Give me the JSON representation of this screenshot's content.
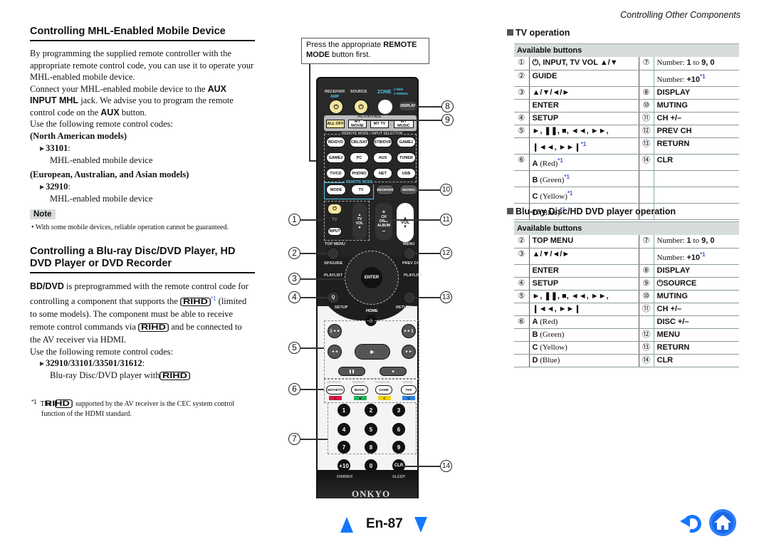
{
  "header": {
    "section_title": "Controlling Other Components"
  },
  "left": {
    "mhl": {
      "title": "Controlling MHL-Enabled Mobile Device",
      "para1": "By programming the supplied remote controller with the appropriate remote control code, you can use it to operate your MHL-enabled mobile device.",
      "para2_a": "Connect your MHL-enabled mobile device to the ",
      "para2_b": "AUX INPUT MHL",
      "para2_c": " jack. We advise you to program the remote control code on the ",
      "para2_d": "AUX",
      "para2_e": " button.",
      "para3": "Use the following remote control codes:",
      "groups": [
        {
          "region": "(North American models)",
          "code": "33101",
          "desc": "MHL-enabled mobile device"
        },
        {
          "region": "(European, Australian, and Asian models)",
          "code": "32910",
          "desc": "MHL-enabled mobile device"
        }
      ],
      "note_label": "Note",
      "note": "With some mobile devices, reliable operation cannot be guaranteed."
    },
    "bd": {
      "title": "Controlling a Blu-ray Disc/DVD Player, HD DVD Player or DVD Recorder",
      "p1_bold": "BD/DVD",
      "p1_a": " is preprogrammed with the remote control code for controlling a component that supports the ",
      "p1_b": " (limited to some models). The component must be able to receive remote control commands via ",
      "p1_c": " and be connected to the AV receiver via HDMI.",
      "p2": "Use the following remote control codes:",
      "code": "32910/33101/33501/31612",
      "desc": "Blu-ray Disc/DVD player with",
      "rihd": "RIHD",
      "footref": "*1",
      "footnote_a": "The ",
      "footnote_b": " supported by the AV receiver is the CEC system control function of the HDMI standard."
    }
  },
  "remote": {
    "callout_a": "Press the appropriate ",
    "callout_b": "REMOTE MODE",
    "callout_c": " button first.",
    "labels": {
      "receiver": "RECEIVER",
      "amp": "AMP",
      "source": "SOURCE",
      "zone": "ZONE",
      "zone2": "2 RED",
      "zone3": "3 GREEN",
      "display": "DISPLAY",
      "activities": "ACTIVITIES",
      "all_off": "ALL OFF",
      "my_movie": "MY MOVIE",
      "my_tv": "MY TV",
      "my_music": "MY MUSIC",
      "selector": "REMOTE MODE / INPUT SELECTOR",
      "row1": [
        "BD/DVD",
        "CBL/SAT",
        "STB/DVR",
        "GAME1"
      ],
      "row2": [
        "GAME2",
        "PC",
        "AUX",
        "TUNER"
      ],
      "row3": [
        "TV/CD",
        "PHONO",
        "NET",
        "USB"
      ],
      "remote_mode": "REMOTE MODE",
      "mode": "MODE",
      "tv": "TV",
      "receiver_btn": "RECEIVER",
      "muting": "MUTING",
      "tv_lbl": "TV",
      "input": "INPUT",
      "tv_vol": "TV VOL",
      "ch": "CH",
      "disc": "DISC",
      "album": "ALBUM",
      "vol": "VOL",
      "top_menu": "TOP MENU",
      "menu": "MENU",
      "sp_guide": "SP/GUIDE",
      "prev_ch": "PREV CH",
      "playlist": "PLAYLIST",
      "enter": "ENTER",
      "setup": "SETUP",
      "return": "RETURN",
      "home": "HOME",
      "q": "Q",
      "search": "SEARCH",
      "repeat": "REPEAT",
      "random": "RANDOM",
      "modeL": "MODE",
      "movie_tv": "MOVIE/TV",
      "music": "MUSIC",
      "game": "GAME",
      "thx": "THX",
      "a": "A",
      "b": "B",
      "c": "C",
      "d": "D",
      "digits": [
        "1",
        "2",
        "3",
        "4",
        "5",
        "6",
        "7",
        "8",
        "9"
      ],
      "plus10": "+10",
      "zero": "0",
      "clr": "CLR",
      "dimmer": "DIMMER",
      "sleep": "SLEEP",
      "brand": "ONKYO"
    },
    "callouts": [
      "1",
      "2",
      "3",
      "4",
      "5",
      "6",
      "7",
      "8",
      "9",
      "10",
      "11",
      "12",
      "13",
      "14"
    ]
  },
  "colors": {
    "accent": "#1477ff",
    "a": "#d8174a",
    "b": "#27b05a",
    "c": "#f2cf0a",
    "d": "#2a7fe0",
    "power": "#f5e6a0"
  },
  "tv_operation": {
    "heading": "TV operation",
    "header": "Available buttons",
    "rows": [
      {
        "n": "①",
        "l": "⏻, INPUT, TV VOL ▲/▼",
        "n2": "⑦",
        "r": "Number: 1 to 9, 0"
      },
      {
        "n": "②",
        "l": "GUIDE",
        "n2": "",
        "r": "Number: +10*1"
      },
      {
        "n": "③",
        "l": "▲/▼/◄/►",
        "n2": "⑧",
        "r": "DISPLAY"
      },
      {
        "n": "",
        "l": "ENTER",
        "n2": "⑩",
        "r": "MUTING"
      },
      {
        "n": "④",
        "l": "SETUP",
        "n2": "⑪",
        "r": "CH +/–"
      },
      {
        "n": "⑤",
        "l": "►, ❚❚, ■, ◄◄, ►►,",
        "n2": "⑫",
        "r": "PREV CH"
      },
      {
        "n": "",
        "l": "❙◄◄, ►►❙*1",
        "n2": "⑬",
        "r": "RETURN"
      },
      {
        "n": "⑥",
        "l": "A (Red)*1",
        "n2": "⑭",
        "r": "CLR"
      },
      {
        "n": "",
        "l": "B (Green)*1",
        "n2": "",
        "r": ""
      },
      {
        "n": "",
        "l": "C (Yellow)*1",
        "n2": "",
        "r": ""
      },
      {
        "n": "",
        "l": "D (Blue)*1",
        "n2": "",
        "r": ""
      }
    ]
  },
  "bd_operation": {
    "heading": "Blu-ray Disc/HD DVD player operation",
    "header": "Available buttons",
    "rows": [
      {
        "n": "②",
        "l": "TOP MENU",
        "n2": "⑦",
        "r": "Number: 1 to 9, 0"
      },
      {
        "n": "③",
        "l": "▲/▼/◄/►",
        "n2": "",
        "r": "Number: +10*1"
      },
      {
        "n": "",
        "l": "ENTER",
        "n2": "⑧",
        "r": "DISPLAY"
      },
      {
        "n": "④",
        "l": "SETUP",
        "n2": "⑨",
        "r": "⏻SOURCE"
      },
      {
        "n": "⑤",
        "l": "►, ❚❚, ■, ◄◄, ►►,",
        "n2": "⑩",
        "r": "MUTING"
      },
      {
        "n": "",
        "l": "❙◄◄, ►►❙",
        "n2": "⑪",
        "r": "CH +/–"
      },
      {
        "n": "⑥",
        "l": "A (Red)",
        "n2": "",
        "r": "DISC +/–"
      },
      {
        "n": "",
        "l": "B (Green)",
        "n2": "⑫",
        "r": "MENU"
      },
      {
        "n": "",
        "l": "C (Yellow)",
        "n2": "⑬",
        "r": "RETURN"
      },
      {
        "n": "",
        "l": "D (Blue)",
        "n2": "⑭",
        "r": "CLR"
      }
    ]
  },
  "footer": {
    "page": "En-87",
    "prev_icon": "triangle-up-icon",
    "next_icon": "triangle-down-icon",
    "back_icon": "back-arrow-icon",
    "home_icon": "home-icon"
  }
}
